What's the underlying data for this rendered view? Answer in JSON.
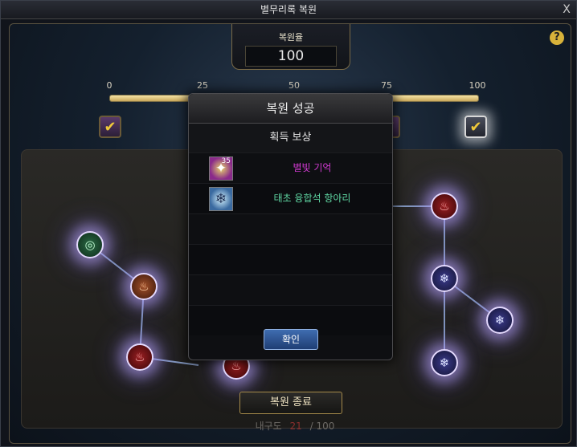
{
  "window": {
    "title": "별무리록 복원",
    "close_label": "X"
  },
  "help": {
    "label": "?"
  },
  "restore_rate": {
    "label": "복원율",
    "value": "100"
  },
  "progress": {
    "ticks": [
      "0",
      "25",
      "50",
      "75",
      "100"
    ],
    "value_percent": 100
  },
  "milestones": [
    {
      "reached": true,
      "icon": "checkmark-icon"
    },
    {
      "reached": true,
      "icon": "checkmark-icon"
    },
    {
      "reached": true,
      "icon": "checkmark-icon"
    }
  ],
  "nodes": [
    {
      "color": "green",
      "icon": "wind-icon"
    },
    {
      "color": "orange",
      "icon": "flame-icon"
    },
    {
      "color": "red",
      "icon": "fire-icon"
    },
    {
      "color": "red",
      "icon": "fire-icon"
    },
    {
      "color": "red",
      "icon": "fire-icon"
    },
    {
      "color": "blue",
      "icon": "snowflake-icon"
    },
    {
      "color": "blue",
      "icon": "snowflake-icon"
    },
    {
      "color": "blue",
      "icon": "snowflake-icon"
    }
  ],
  "end_button": {
    "label": "복원 종료"
  },
  "durability": {
    "label": "내구도",
    "current": "21",
    "separator": "/",
    "max": "100"
  },
  "modal": {
    "title": "복원 성공",
    "rewards_header": "획득 보상",
    "rewards": [
      {
        "name": "별빛 기억",
        "qty": "35",
        "color": "#d23ad2",
        "icon": "starlight-icon"
      },
      {
        "name": "태초 융합석 항아리",
        "qty": "",
        "color": "#5fd6a2",
        "icon": "jar-icon"
      }
    ],
    "confirm_label": "확인"
  }
}
